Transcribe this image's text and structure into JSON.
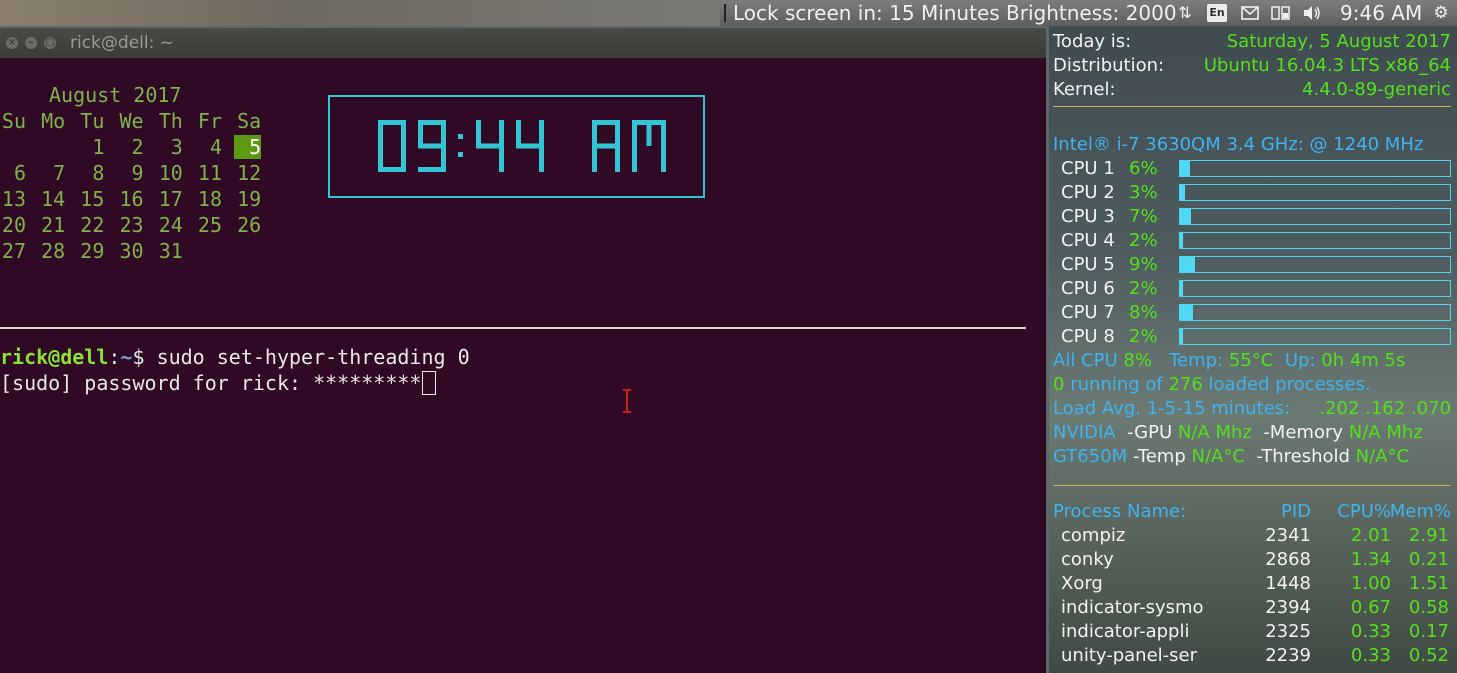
{
  "top_panel": {
    "indicator_text": "Lock screen in: 15 Minutes Brightness: 2000",
    "keyboard_layout": "En",
    "clock": "9:46 AM",
    "icons": [
      "transfer-arrows-icon",
      "keyboard-layout-icon",
      "mail-icon",
      "battery-icon",
      "volume-icon",
      "gear-icon"
    ]
  },
  "terminal": {
    "title": "rick@dell: ~",
    "calendar": {
      "month_label": "August 2017",
      "weekdays": [
        "Su",
        "Mo",
        "Tu",
        "We",
        "Th",
        "Fr",
        "Sa"
      ],
      "weeks": [
        [
          "",
          "",
          "1",
          "2",
          "3",
          "4",
          "5"
        ],
        [
          "6",
          "7",
          "8",
          "9",
          "10",
          "11",
          "12"
        ],
        [
          "13",
          "14",
          "15",
          "16",
          "17",
          "18",
          "19"
        ],
        [
          "20",
          "21",
          "22",
          "23",
          "24",
          "25",
          "26"
        ],
        [
          "27",
          "28",
          "29",
          "30",
          "31",
          "",
          ""
        ]
      ],
      "today": "5"
    },
    "clock_display": "09:44 AM",
    "lines": {
      "prompt_user": "rick@dell",
      "prompt_sep": ":",
      "prompt_path": "~",
      "prompt_symbol": "$ ",
      "command": "sudo set-hyper-threading 0",
      "password_prompt": "[sudo] password for rick: *********"
    }
  },
  "conky": {
    "today_label": "Today is:",
    "today_value": "Saturday,  5 August 2017",
    "distro_label": "Distribution:",
    "distro_value": "Ubuntu 16.04.3 LTS x86_64",
    "kernel_label": "Kernel:",
    "kernel_value": "4.4.0-89-generic",
    "cpu_model": "Intel® i-7 3630QM 3.4 GHz: @  1240 MHz",
    "cpus": [
      {
        "label": "CPU 1",
        "pct": "6%",
        "fill": 0.06
      },
      {
        "label": "CPU 2",
        "pct": "3%",
        "fill": 0.03
      },
      {
        "label": "CPU 3",
        "pct": "7%",
        "fill": 0.07
      },
      {
        "label": "CPU 4",
        "pct": "2%",
        "fill": 0.02
      },
      {
        "label": "CPU 5",
        "pct": "9%",
        "fill": 0.09
      },
      {
        "label": "CPU 6",
        "pct": "2%",
        "fill": 0.02
      },
      {
        "label": "CPU 7",
        "pct": "8%",
        "fill": 0.08
      },
      {
        "label": "CPU 8",
        "pct": "2%",
        "fill": 0.02
      }
    ],
    "all_cpu_label": "All CPU",
    "all_cpu_value": "8%",
    "temp_label": "Temp:",
    "temp_value": "55°C",
    "uptime_label": "Up:",
    "uptime_value": "0h 4m 5s",
    "running_count": "0",
    "running_text": "running of",
    "loaded_count": "276",
    "loaded_text": "loaded processes.",
    "load_label": "Load Avg. 1-5-15 minutes:",
    "load_value": ".202 .162 .070",
    "gpu_vendor": "NVIDIA",
    "gpu_label": "-GPU",
    "gpu_value": "N/A Mhz",
    "mem_label": "-Memory",
    "mem_value": "N/A Mhz",
    "gpu_model": "GT650M",
    "gtemp_label": "-Temp",
    "gtemp_value": "N/A°C",
    "thresh_label": "-Threshold",
    "thresh_value": "N/A°C",
    "proc_headers": {
      "name": "Process Name:",
      "pid": "PID",
      "cpu": "CPU%",
      "mem": "Mem%"
    },
    "processes": [
      {
        "name": "compiz",
        "pid": "2341",
        "cpu": "2.01",
        "mem": "2.91"
      },
      {
        "name": "conky",
        "pid": "2868",
        "cpu": "1.34",
        "mem": "0.21"
      },
      {
        "name": "Xorg",
        "pid": "1448",
        "cpu": "1.00",
        "mem": "1.51"
      },
      {
        "name": "indicator-sysmo",
        "pid": "2394",
        "cpu": "0.67",
        "mem": "0.58"
      },
      {
        "name": "indicator-appli",
        "pid": "2325",
        "cpu": "0.33",
        "mem": "0.17"
      },
      {
        "name": "unity-panel-ser",
        "pid": "2239",
        "cpu": "0.33",
        "mem": "0.52"
      }
    ]
  }
}
